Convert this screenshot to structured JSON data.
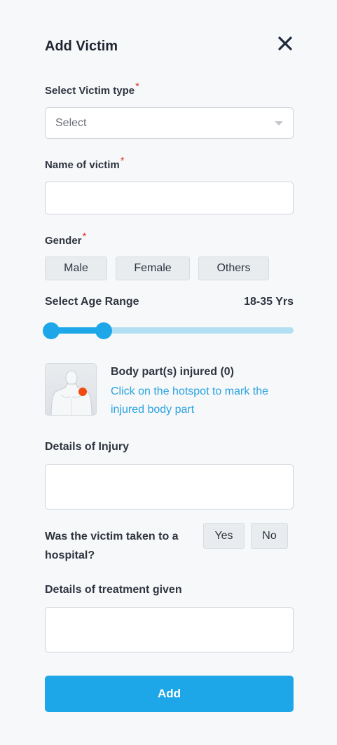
{
  "header": {
    "title": "Add Victim",
    "close_icon": "close-icon"
  },
  "victim_type": {
    "label": "Select Victim type",
    "required_mark": "*",
    "placeholder": "Select"
  },
  "victim_name": {
    "label": "Name of victim",
    "required_mark": "*",
    "value": ""
  },
  "gender": {
    "label": "Gender",
    "required_mark": "*",
    "options": [
      "Male",
      "Female",
      "Others"
    ]
  },
  "age_range": {
    "label": "Select Age Range",
    "value_text": "18-35 Yrs"
  },
  "body_parts": {
    "title": "Body part(s) injured (0)",
    "hint": "Click on the hotspot to mark the injured body part",
    "hotspot_color": "#f04a12"
  },
  "injury_details": {
    "label": "Details of Injury",
    "value": ""
  },
  "hospital": {
    "question": "Was the victim taken to a hospital?",
    "yes_label": "Yes",
    "no_label": "No"
  },
  "treatment_details": {
    "label": "Details of treatment given",
    "value": ""
  },
  "submit": {
    "label": "Add"
  },
  "colors": {
    "accent": "#1ea7e8",
    "required": "#e53935",
    "link": "#2aa3e0"
  }
}
